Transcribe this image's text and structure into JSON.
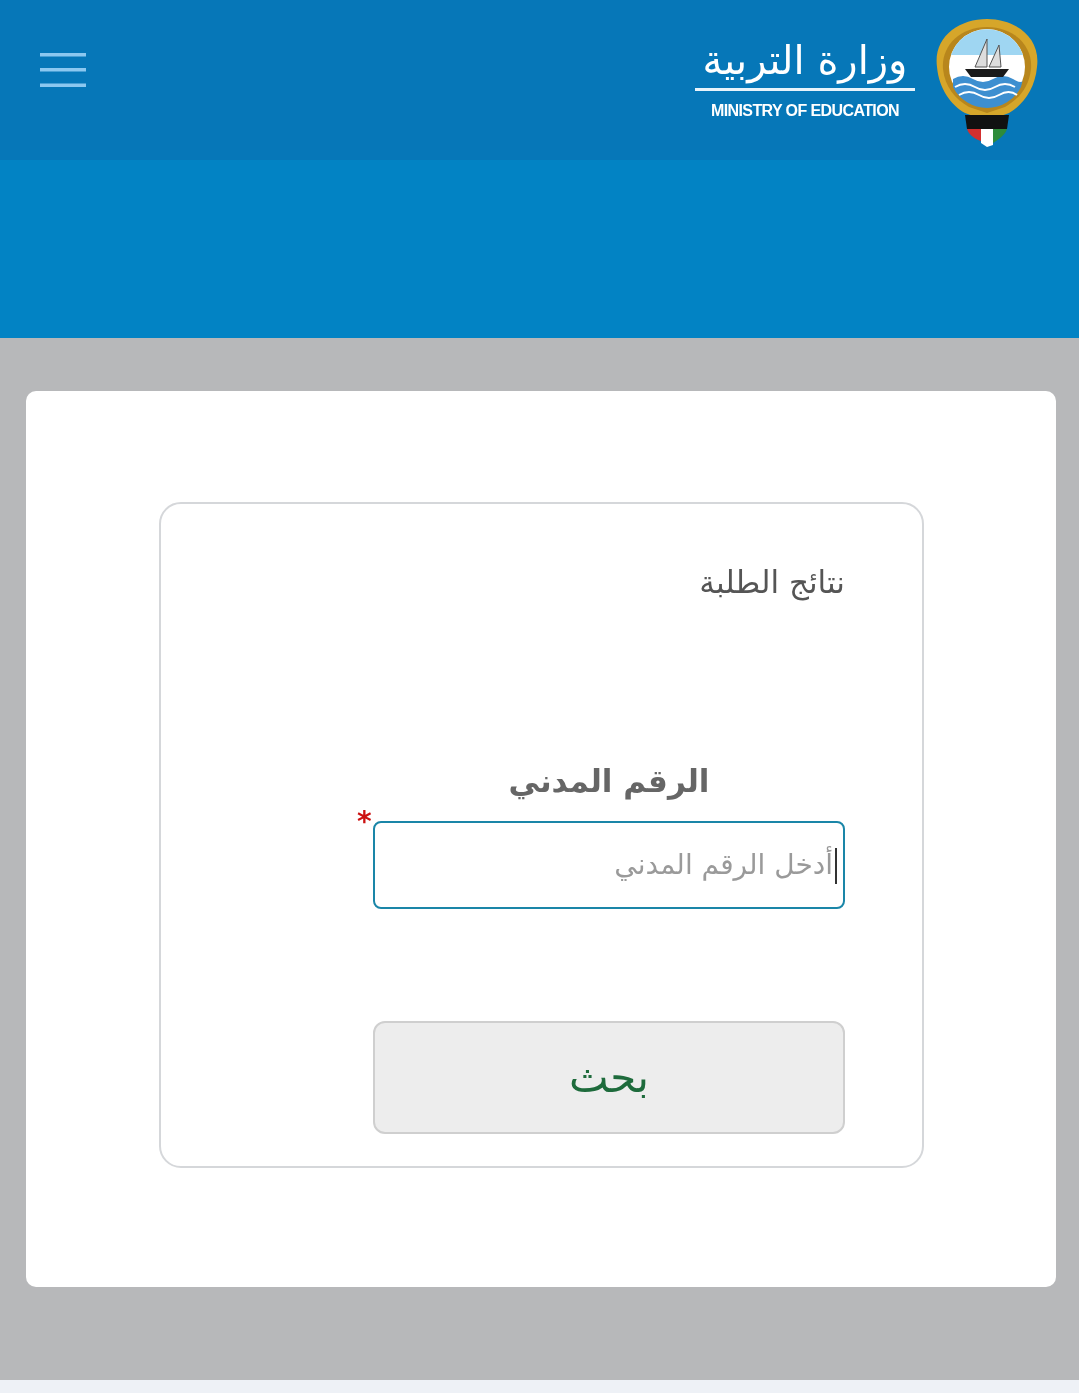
{
  "header": {
    "logo": {
      "title_ar": "وزارة التربية",
      "title_en": "MINISTRY OF EDUCATION"
    }
  },
  "form": {
    "title": "نتائج الطلبة",
    "field": {
      "label": "الرقم المدني",
      "required_mark": "*",
      "placeholder": "أدخل الرقم المدني",
      "focused": true
    },
    "submit_button": "بحث"
  }
}
